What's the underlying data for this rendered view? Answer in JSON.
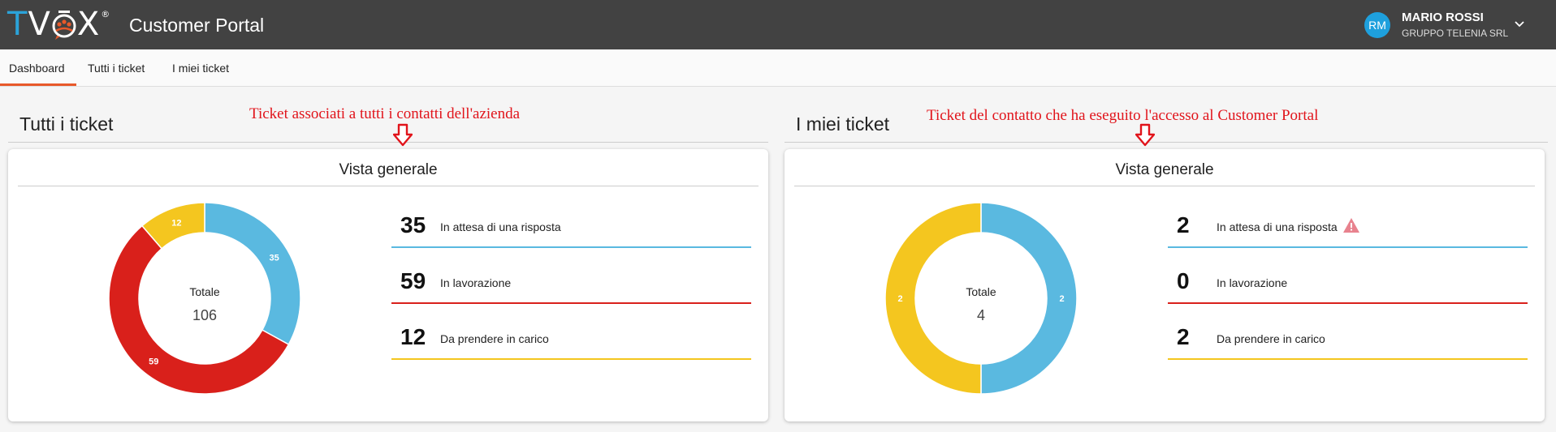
{
  "header": {
    "logo_text": "TVOX",
    "app_title": "Customer Portal",
    "user": {
      "initials": "RM",
      "name": "MARIO ROSSI",
      "org": "GRUPPO TELENIA SRL"
    }
  },
  "tabs": [
    {
      "label": "Dashboard",
      "active": true
    },
    {
      "label": "Tutti i ticket",
      "active": false
    },
    {
      "label": "I miei ticket",
      "active": false
    }
  ],
  "colors": {
    "awaiting": "#5ab9e0",
    "working": "#d9201b",
    "to_take": "#f4c61f",
    "topbar": "#424242",
    "tab_accent": "#e8592a"
  },
  "sections": [
    {
      "title": "Tutti i ticket",
      "annotation": "Ticket associati a tutti i contatti dell'azienda",
      "card_title": "Vista generale",
      "total_label": "Totale",
      "total": "106",
      "stats": [
        {
          "value": "35",
          "label": "In attesa di una risposta",
          "color": "#5ab9e0",
          "warning": false
        },
        {
          "value": "59",
          "label": "In lavorazione",
          "color": "#d9201b",
          "warning": false
        },
        {
          "value": "12",
          "label": "Da prendere in carico",
          "color": "#f4c61f",
          "warning": false
        }
      ]
    },
    {
      "title": "I miei ticket",
      "annotation": "Ticket del contatto che ha eseguito l'accesso al Customer Portal",
      "card_title": "Vista generale",
      "total_label": "Totale",
      "total": "4",
      "stats": [
        {
          "value": "2",
          "label": "In attesa di una risposta",
          "color": "#5ab9e0",
          "warning": true
        },
        {
          "value": "0",
          "label": "In lavorazione",
          "color": "#d9201b",
          "warning": false
        },
        {
          "value": "2",
          "label": "Da prendere in carico",
          "color": "#f4c61f",
          "warning": false
        }
      ]
    }
  ]
}
